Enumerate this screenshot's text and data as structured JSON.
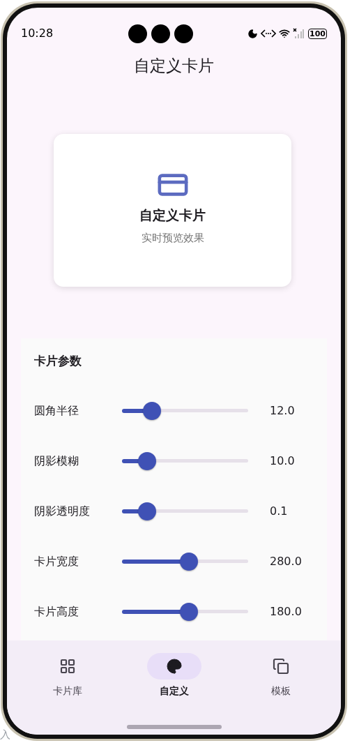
{
  "status_bar": {
    "time": "10:28",
    "battery": "100"
  },
  "title": "自定义卡片",
  "preview": {
    "title": "自定义卡片",
    "subtitle": "实时预览效果"
  },
  "params": {
    "heading": "卡片参数",
    "rows": [
      {
        "label": "圆角半径",
        "level": 0.24,
        "reading": "12.0"
      },
      {
        "label": "阴影模糊",
        "level": 0.2,
        "reading": "10.0"
      },
      {
        "label": "阴影透明度",
        "level": 0.2,
        "reading": "0.1"
      },
      {
        "label": "卡片宽度",
        "level": 0.53,
        "reading": "280.0"
      },
      {
        "label": "卡片高度",
        "level": 0.53,
        "reading": "180.0"
      }
    ]
  },
  "nav": [
    {
      "label": "卡片库",
      "kind": "grid",
      "selected": false
    },
    {
      "label": "自定义",
      "kind": "palette",
      "selected": true
    },
    {
      "label": "模板",
      "kind": "copy",
      "selected": false
    }
  ],
  "background_text": "入"
}
